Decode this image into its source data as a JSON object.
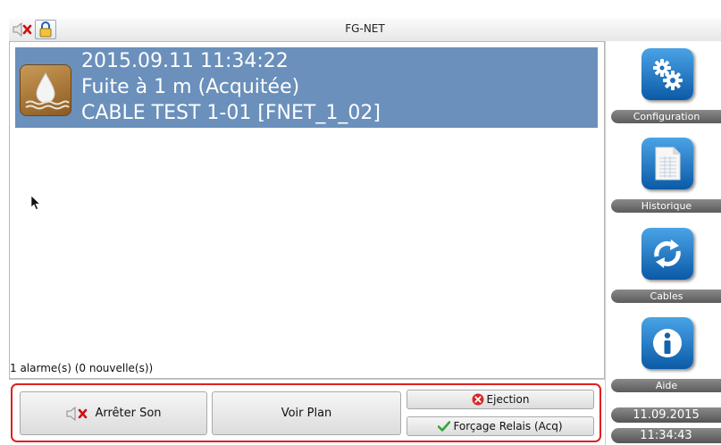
{
  "window": {
    "title": "FG-NET"
  },
  "toolbar": {
    "sound_icon": "speaker-muted-icon",
    "lock_icon": "padlock-icon"
  },
  "alarm": {
    "icon": "water-leak-icon",
    "datetime": "2015.09.11 11:34:22",
    "message": "Fuite à 1 m  (Acquitée)",
    "source": "CABLE TEST 1-01 [FNET_1_02]",
    "row_color": "#6a90bb"
  },
  "status": {
    "summary": "1 alarme(s) (0 nouvelle(s))"
  },
  "sidebar": {
    "items": [
      {
        "label": "Configuration",
        "icon": "gears-icon"
      },
      {
        "label": "Historique",
        "icon": "document-icon"
      },
      {
        "label": "Cables",
        "icon": "refresh-arrows-icon"
      },
      {
        "label": "Aide",
        "icon": "info-icon"
      }
    ]
  },
  "clock": {
    "date": "11.09.2015",
    "time": "11:34:43"
  },
  "actions": {
    "stop_sound": "Arrêter Son",
    "view_plan": "Voir Plan",
    "ejection": "Ejection",
    "force_relay": "Forçage Relais (Acq)"
  },
  "colors": {
    "accent_red": "#e02020",
    "sidebar_blue": "#1a6fc0"
  }
}
